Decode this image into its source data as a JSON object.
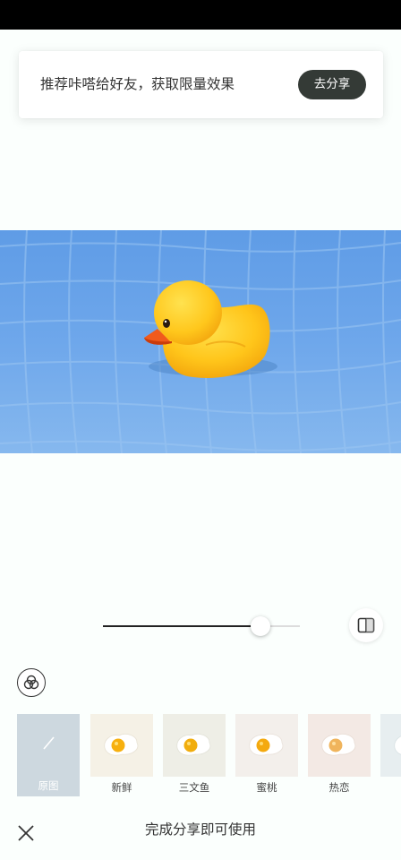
{
  "banner": {
    "text": "推荐咔嗒给好友，获取限量效果",
    "button_label": "去分享"
  },
  "photo": {
    "subject": "rubber-duck-in-pool"
  },
  "intensity_slider": {
    "value_fraction": 0.8
  },
  "icons": {
    "compare": "compare-icon",
    "blend": "blend-circles-icon",
    "close": "close-icon",
    "none": "slash-icon"
  },
  "filters": [
    {
      "label": "原图",
      "selected": true
    },
    {
      "label": "新鲜",
      "tint": "#f5f1e6"
    },
    {
      "label": "三文鱼",
      "tint": "#eeeee6"
    },
    {
      "label": "蜜桃",
      "tint": "#f3efeb"
    },
    {
      "label": "热恋",
      "tint": "#f3e9e4"
    },
    {
      "label": "",
      "tint": "#e7eef0"
    }
  ],
  "footer": {
    "finish_text": "完成分享即可使用"
  },
  "colors": {
    "accent_dark": "#343a36",
    "water": "#6aa3e6",
    "duck_yellow": "#ffc51a",
    "beak": "#f05a1c",
    "original_tile": "#cdd8df"
  }
}
